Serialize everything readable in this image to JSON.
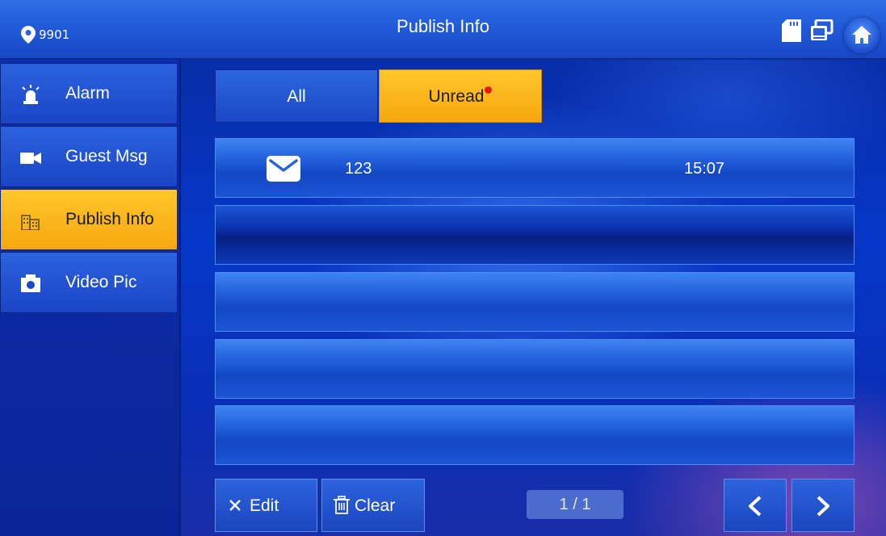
{
  "header": {
    "room_number": "9901",
    "title": "Publish Info",
    "icons": [
      "location-pin-icon",
      "sd-card-icon",
      "monitor-icon",
      "home-icon"
    ]
  },
  "sidebar": {
    "items": [
      {
        "label": "Alarm",
        "icon": "alarm-bell-icon",
        "active": false
      },
      {
        "label": "Guest Msg",
        "icon": "video-camera-icon",
        "active": false
      },
      {
        "label": "Publish Info",
        "icon": "building-icon",
        "active": true
      },
      {
        "label": "Video Pic",
        "icon": "camera-icon",
        "active": false
      }
    ]
  },
  "tabs": {
    "all": "All",
    "unread": "Unread",
    "selected": "Unread"
  },
  "messages": [
    {
      "title": "123",
      "time": "15:07",
      "icon": "envelope-icon"
    }
  ],
  "footer": {
    "edit_label": "Edit",
    "clear_label": "Clear",
    "page_indicator": "1 / 1"
  },
  "colors": {
    "accent": "#f7b11a",
    "unread_dot": "#e8170f",
    "background": "#0637c8"
  }
}
